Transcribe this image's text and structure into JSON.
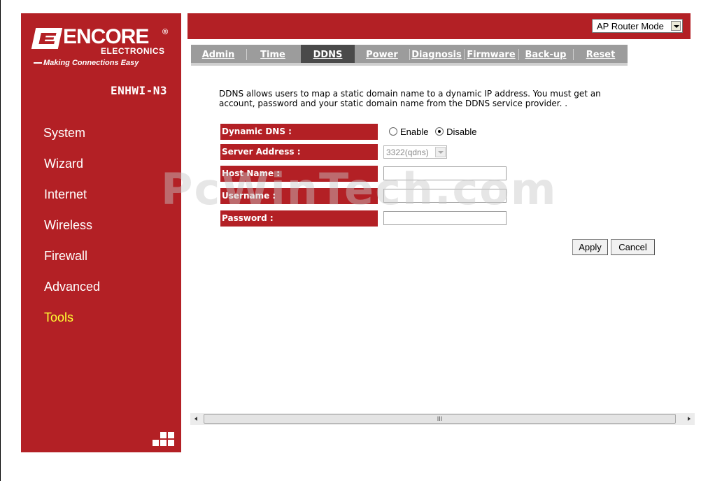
{
  "brand": {
    "logo_name": "ENCORE",
    "logo_reg": "®",
    "logo_sub": "ELECTRONICS",
    "tagline": "Making Connections Easy",
    "model": "ENHWI-N3"
  },
  "sidebar": {
    "items": [
      {
        "label": "System"
      },
      {
        "label": "Wizard"
      },
      {
        "label": "Internet"
      },
      {
        "label": "Wireless"
      },
      {
        "label": "Firewall"
      },
      {
        "label": "Advanced"
      },
      {
        "label": "Tools"
      }
    ],
    "active": "Tools"
  },
  "header": {
    "mode_select_value": "AP Router Mode"
  },
  "tabs": {
    "items": [
      {
        "label": "Admin"
      },
      {
        "label": "Time"
      },
      {
        "label": "DDNS"
      },
      {
        "label": "Power"
      },
      {
        "label": "Diagnosis"
      },
      {
        "label": "Firmware"
      },
      {
        "label": "Back-up"
      },
      {
        "label": "Reset"
      }
    ],
    "active": "DDNS"
  },
  "ddns": {
    "description": "DDNS allows users to map a static domain name to a dynamic IP address. You must get an account, password and your static domain name from the DDNS service provider. .",
    "dynamic_dns_label": "Dynamic DNS :",
    "enable_label": "Enable",
    "disable_label": "Disable",
    "selected": "Disable",
    "server_address_label": "Server Address :",
    "server_address_value": "3322(qdns)",
    "host_name_label": "Host Name :",
    "host_name_value": "",
    "username_label": "Username :",
    "username_value": "",
    "password_label": "Password :",
    "password_value": "",
    "apply_label": "Apply",
    "cancel_label": "Cancel"
  },
  "watermark": "PcWinTech.com",
  "scrollbar": {
    "thumb_grip": "III"
  },
  "colors": {
    "brand_red": "#b32025",
    "tab_gray": "#9c9c9c",
    "tab_active": "#4a4a4a",
    "active_nav": "#ffff33"
  },
  "icons": {
    "bottom_sidebar": "grid-icon"
  }
}
